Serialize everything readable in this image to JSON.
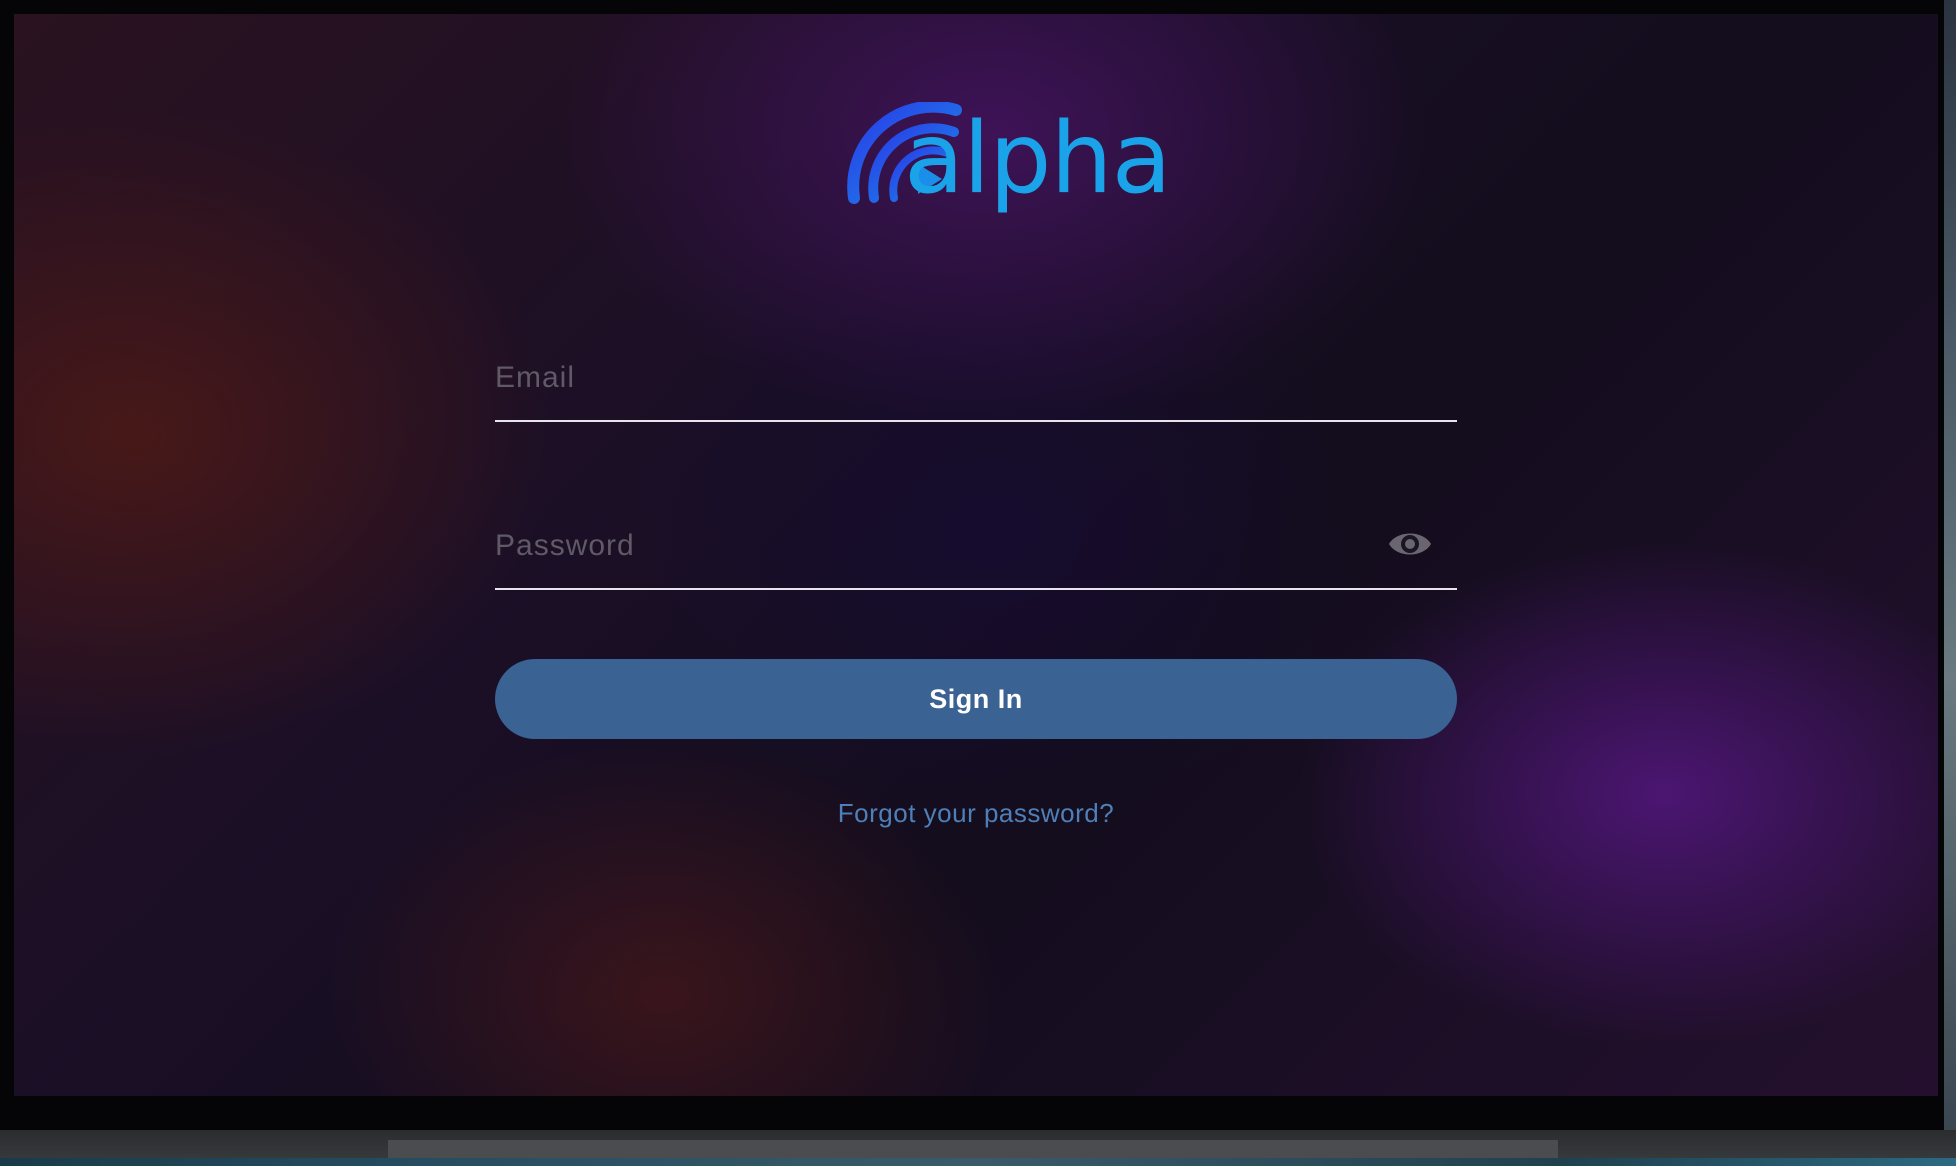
{
  "app": {
    "logo_text": "alpha",
    "brand_color": "#1aa3e8"
  },
  "form": {
    "email": {
      "placeholder": "Email",
      "value": ""
    },
    "password": {
      "placeholder": "Password",
      "value": "",
      "toggle_icon": "eye-icon"
    },
    "signin_label": "Sign In",
    "forgot_label": "Forgot your password?"
  },
  "colors": {
    "button_bg": "#3a6293",
    "link": "#4f7fb8",
    "underline": "#e8e4ee"
  }
}
